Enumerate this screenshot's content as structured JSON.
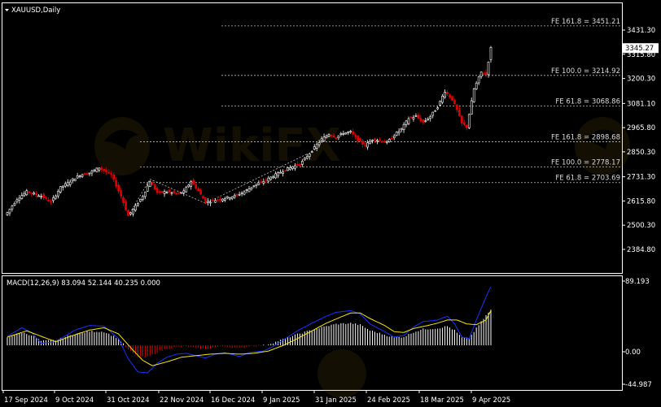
{
  "window": {
    "title": "XAUUSD,Daily",
    "symbol": "XAUUSD",
    "timeframe": "Daily"
  },
  "watermark": "WikiFX",
  "colors": {
    "background": "#000000",
    "grid": "#ffffff",
    "bull_candle": "#ffffff",
    "bear_candle": "#e00000",
    "fib_line": "#bfbfbf",
    "macd_line": "#1a33ff",
    "signal_line": "#f5e60a",
    "histogram_pos": "#ffffff",
    "histogram_neg": "#e00000",
    "trendline": "#bfbfbf"
  },
  "price_axis": {
    "ticks": [
      "3431.30",
      "3315.80",
      "3200.30",
      "3081.10",
      "2965.80",
      "2850.30",
      "2731.30",
      "2615.80",
      "2500.30",
      "2384.80"
    ],
    "current_price": "3345.27"
  },
  "time_axis": {
    "ticks": [
      "17 Sep 2024",
      "9 Oct 2024",
      "31 Oct 2024",
      "22 Nov 2024",
      "16 Dec 2024",
      "9 Jan 2025",
      "31 Jan 2025",
      "24 Feb 2025",
      "18 Mar 2025",
      "9 Apr 2025"
    ]
  },
  "fib_levels": [
    {
      "label": "FE 161.8 = 3451.21",
      "price": 3451.21
    },
    {
      "label": "FE 100.0 = 3214.92",
      "price": 3214.92
    },
    {
      "label": "FE 61.8 = 3068.86",
      "price": 3068.86
    },
    {
      "label": "FE 161.8 = 2898.68",
      "price": 2898.68
    },
    {
      "label": "FE 100.0 = 2778.17",
      "price": 2778.17
    },
    {
      "label": "FE 61.8 = 2703.69",
      "price": 2703.69
    }
  ],
  "macd_panel": {
    "label": "MACD(12,26,9) 83.094 52.144 40.235 0.000",
    "ticks": [
      "89.193",
      "0.00",
      "-44.987"
    ]
  },
  "chart_data": [
    {
      "type": "candlestick",
      "title": "XAUUSD,Daily",
      "ylim": [
        2384.8,
        3480
      ],
      "close_waypoints": [
        [
          0,
          2560
        ],
        [
          4,
          2625
        ],
        [
          8,
          2660
        ],
        [
          11,
          2650
        ],
        [
          14,
          2640
        ],
        [
          18,
          2610
        ],
        [
          22,
          2680
        ],
        [
          26,
          2710
        ],
        [
          30,
          2740
        ],
        [
          34,
          2750
        ],
        [
          38,
          2775
        ],
        [
          40,
          2760
        ],
        [
          43,
          2740
        ],
        [
          47,
          2640
        ],
        [
          50,
          2545
        ],
        [
          53,
          2590
        ],
        [
          56,
          2640
        ],
        [
          59,
          2710
        ],
        [
          62,
          2655
        ],
        [
          66,
          2660
        ],
        [
          70,
          2650
        ],
        [
          73,
          2660
        ],
        [
          76,
          2710
        ],
        [
          79,
          2665
        ],
        [
          82,
          2610
        ],
        [
          86,
          2620
        ],
        [
          90,
          2630
        ],
        [
          94,
          2640
        ],
        [
          98,
          2660
        ],
        [
          102,
          2690
        ],
        [
          106,
          2710
        ],
        [
          110,
          2735
        ],
        [
          114,
          2760
        ],
        [
          118,
          2780
        ],
        [
          121,
          2790
        ],
        [
          124,
          2830
        ],
        [
          127,
          2870
        ],
        [
          130,
          2910
        ],
        [
          133,
          2935
        ],
        [
          136,
          2920
        ],
        [
          139,
          2940
        ],
        [
          142,
          2945
        ],
        [
          145,
          2905
        ],
        [
          148,
          2880
        ],
        [
          151,
          2910
        ],
        [
          154,
          2905
        ],
        [
          157,
          2895
        ],
        [
          160,
          2930
        ],
        [
          163,
          2960
        ],
        [
          166,
          3010
        ],
        [
          169,
          3020
        ],
        [
          172,
          2990
        ],
        [
          175,
          3020
        ],
        [
          178,
          3065
        ],
        [
          181,
          3140
        ],
        [
          184,
          3100
        ],
        [
          186,
          3050
        ],
        [
          188,
          2985
        ],
        [
          190,
          2970
        ],
        [
          193,
          3150
        ],
        [
          196,
          3230
        ],
        [
          198,
          3220
        ],
        [
          200,
          3345.27
        ]
      ],
      "last_close": 3345.27
    },
    {
      "type": "line",
      "title": "MACD(12,26,9) 83.094 52.144 40.235 0.000",
      "ylim": [
        -44.987,
        89.193
      ],
      "series": [
        {
          "name": "MACD",
          "points": [
            [
              0,
              19
            ],
            [
              6,
              30
            ],
            [
              10,
              24
            ],
            [
              14,
              10
            ],
            [
              20,
              12
            ],
            [
              28,
              27
            ],
            [
              34,
              33
            ],
            [
              40,
              32
            ],
            [
              46,
              16
            ],
            [
              50,
              -10
            ],
            [
              54,
              -27
            ],
            [
              58,
              -28
            ],
            [
              62,
              -16
            ],
            [
              66,
              -8
            ],
            [
              70,
              -4
            ],
            [
              74,
              -3
            ],
            [
              78,
              -6
            ],
            [
              82,
              -9
            ],
            [
              86,
              -4
            ],
            [
              90,
              -2
            ],
            [
              96,
              -7
            ],
            [
              100,
              -2
            ],
            [
              106,
              0
            ],
            [
              110,
              6
            ],
            [
              116,
              18
            ],
            [
              120,
              26
            ],
            [
              126,
              36
            ],
            [
              132,
              45
            ],
            [
              136,
              50
            ],
            [
              142,
              52
            ],
            [
              146,
              48
            ],
            [
              150,
              35
            ],
            [
              156,
              25
            ],
            [
              160,
              18
            ],
            [
              164,
              20
            ],
            [
              168,
              31
            ],
            [
              172,
              38
            ],
            [
              178,
              40
            ],
            [
              182,
              45
            ],
            [
              185,
              35
            ],
            [
              188,
              18
            ],
            [
              191,
              16
            ],
            [
              194,
              40
            ],
            [
              198,
              70
            ],
            [
              200,
              83.094
            ]
          ]
        },
        {
          "name": "Signal",
          "points": [
            [
              0,
              18
            ],
            [
              8,
              26
            ],
            [
              14,
              19
            ],
            [
              20,
              12
            ],
            [
              28,
              21
            ],
            [
              34,
              27
            ],
            [
              40,
              30
            ],
            [
              46,
              22
            ],
            [
              52,
              1
            ],
            [
              56,
              -12
            ],
            [
              60,
              -19
            ],
            [
              66,
              -14
            ],
            [
              72,
              -8
            ],
            [
              78,
              -6
            ],
            [
              84,
              -4
            ],
            [
              90,
              -3
            ],
            [
              96,
              -4
            ],
            [
              102,
              -3
            ],
            [
              108,
              0
            ],
            [
              114,
              7
            ],
            [
              120,
              16
            ],
            [
              126,
              26
            ],
            [
              132,
              36
            ],
            [
              138,
              44
            ],
            [
              142,
              49
            ],
            [
              146,
              49
            ],
            [
              150,
              42
            ],
            [
              156,
              33
            ],
            [
              160,
              25
            ],
            [
              164,
              24
            ],
            [
              168,
              29
            ],
            [
              174,
              33
            ],
            [
              178,
              36
            ],
            [
              182,
              40
            ],
            [
              186,
              40
            ],
            [
              190,
              35
            ],
            [
              194,
              34
            ],
            [
              198,
              40
            ],
            [
              200,
              52.144
            ]
          ]
        }
      ],
      "histogram_last": 40.235
    }
  ]
}
